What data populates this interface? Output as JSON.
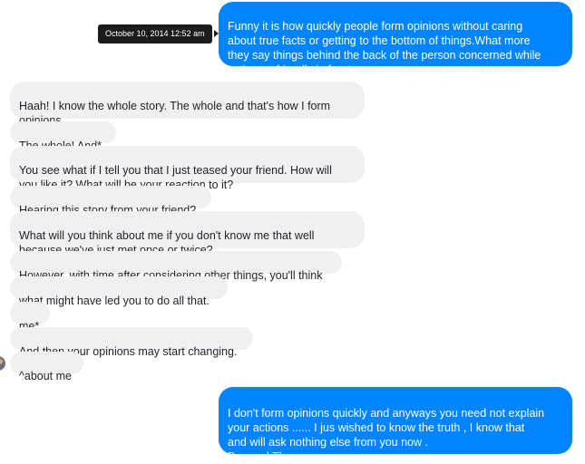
{
  "tooltip": {
    "timestamp": "October 10, 2014 12:52 am"
  },
  "messages": {
    "sent_1": "Funny it is how quickly people form opinions without caring\nabout true facts or getting to the bottom of things.What more\nthey say things behind the back of the person concerned while\nacting so friendly in front.",
    "received": [
      "Haah! I know the whole story. The whole and that's how I form\nopinions.",
      "The whole! And*",
      "You see what if I tell you that I just teased your friend. How will\nyou like it? What will be your reaction to it?",
      "Hearing this story from your friend?",
      "What will you think about me if you don't know me that well\nbecause we've just met once or twice?",
      "However, with time after considering other things, you'll think",
      "what might have led you to do all that.",
      "me*",
      "And then your opinions may start changing.",
      "^about me"
    ],
    "sent_2": "I don't form opinions quickly and anyways you need not explain\nyour actions ...... I jus wished to know the truth , I know that\nand will ask nothing else from you now .\nBye and Thnx"
  }
}
